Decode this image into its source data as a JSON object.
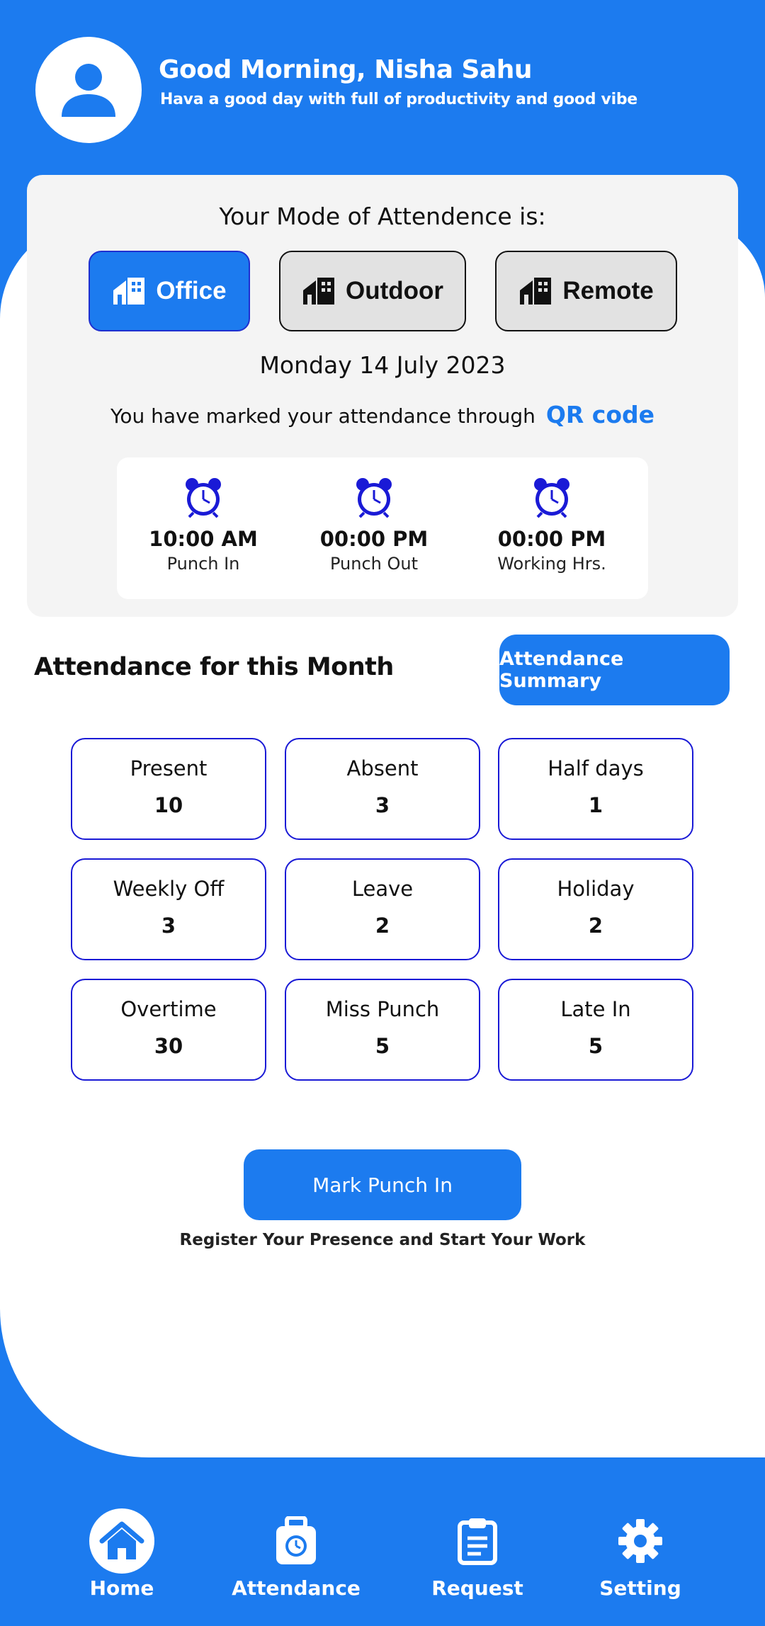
{
  "header": {
    "greeting": "Good Morning, Nisha Sahu",
    "tagline": "Hava a good day with full of productivity and good vibe",
    "avatar_icon": "person-icon"
  },
  "mode_card": {
    "title": "Your Mode of Attendence is:",
    "modes": [
      {
        "label": "Office",
        "icon": "building-icon",
        "selected": true
      },
      {
        "label": "Outdoor",
        "icon": "building-icon",
        "selected": false
      },
      {
        "label": "Remote",
        "icon": "building-icon",
        "selected": false
      }
    ],
    "date": "Monday 14 July 2023",
    "marked_text": "You have marked your attendance through",
    "marked_method": "QR code",
    "times": [
      {
        "value": "10:00 AM",
        "label": "Punch In",
        "icon": "alarm-clock-icon"
      },
      {
        "value": "00:00 PM",
        "label": "Punch Out",
        "icon": "alarm-clock-icon"
      },
      {
        "value": "00:00 PM",
        "label": "Working Hrs.",
        "icon": "alarm-clock-icon"
      }
    ]
  },
  "month": {
    "title": "Attendance for this Month",
    "summary_button": "Attendance Summary",
    "stats": [
      {
        "label": "Present",
        "value": "10"
      },
      {
        "label": "Absent",
        "value": "3"
      },
      {
        "label": "Half days",
        "value": "1"
      },
      {
        "label": "Weekly Off",
        "value": "3"
      },
      {
        "label": "Leave",
        "value": "2"
      },
      {
        "label": "Holiday",
        "value": "2"
      },
      {
        "label": "Overtime",
        "value": "30"
      },
      {
        "label": "Miss Punch",
        "value": "5"
      },
      {
        "label": "Late In",
        "value": "5"
      }
    ]
  },
  "punch": {
    "button": "Mark Punch In",
    "subtitle": "Register Your Presence and Start Your Work"
  },
  "nav": {
    "items": [
      {
        "label": "Home",
        "icon": "home-icon",
        "active": true
      },
      {
        "label": "Attendance",
        "icon": "attendance-clock-icon",
        "active": false
      },
      {
        "label": "Request",
        "icon": "clipboard-icon",
        "active": false
      },
      {
        "label": "Setting",
        "icon": "gear-icon",
        "active": false
      }
    ]
  },
  "colors": {
    "primary": "#1c7bef",
    "stat_border": "#1a1ad6",
    "card_bg": "#f4f4f4",
    "clock_blue": "#1a1ad6"
  }
}
